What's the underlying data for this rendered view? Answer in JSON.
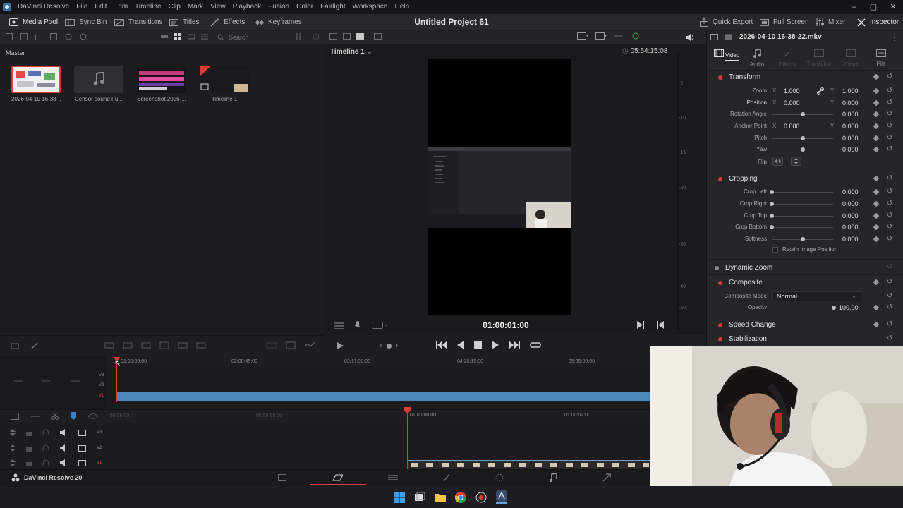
{
  "menubar": {
    "app_title": "DaVinci Resolve",
    "items": [
      "File",
      "Edit",
      "Trim",
      "Timeline",
      "Clip",
      "Mark",
      "View",
      "Playback",
      "Fusion",
      "Color",
      "Fairlight",
      "Workspace",
      "Help"
    ]
  },
  "toolbar": {
    "media_pool": "Media Pool",
    "sync_bin": "Sync Bin",
    "transitions": "Transitions",
    "titles": "Titles",
    "effects": "Effects",
    "keyframes": "Keyframes",
    "project_title": "Untitled Project 61",
    "quick_export": "Quick Export",
    "full_screen": "Full Screen",
    "mixer": "Mixer",
    "inspector": "Inspector"
  },
  "mediapool": {
    "search_placeholder": "Search",
    "bin": "Master",
    "clips": [
      {
        "name": "2026-04-10 16-38-..."
      },
      {
        "name": "Censor sound Fu..."
      },
      {
        "name": "Screenshot 2026-..."
      },
      {
        "name": "Timeline 1"
      }
    ]
  },
  "viewer": {
    "timeline_name": "Timeline 1",
    "source_timecode": "05:54:15:08",
    "timecode": "01:00:01:00"
  },
  "meter": {
    "ticks": [
      "-5",
      "-10",
      "-15",
      "-20",
      "-30",
      "-40",
      "-50"
    ]
  },
  "inspector": {
    "file_name": "2026-04-10 16-38-22.mkv",
    "tabs": [
      "Video",
      "Audio",
      "Effects",
      "Transition",
      "Image",
      "File"
    ],
    "transform": {
      "title": "Transform",
      "zoom_label": "Zoom",
      "zoom_x": "1.000",
      "zoom_y": "1.000",
      "position_label": "Position",
      "position_x": "0.000",
      "position_y": "0.000",
      "rotation_label": "Rotation Angle",
      "rotation": "0.000",
      "anchor_label": "Anchor Point",
      "anchor_x": "0.000",
      "anchor_y": "0.000",
      "pitch_label": "Pitch",
      "pitch": "0.000",
      "yaw_label": "Yaw",
      "yaw": "0.000",
      "flip_label": "Flip",
      "x_label": "X",
      "y_label": "Y"
    },
    "cropping": {
      "title": "Cropping",
      "crop_left_label": "Crop Left",
      "crop_left": "0.000",
      "crop_right_label": "Crop Right",
      "crop_right": "0.000",
      "crop_top_label": "Crop Top",
      "crop_top": "0.000",
      "crop_bottom_label": "Crop Bottom",
      "crop_bottom": "0.000",
      "softness_label": "Softness",
      "softness": "0.000",
      "retain_label": "Retain Image Position"
    },
    "dynamic_zoom": "Dynamic Zoom",
    "composite": {
      "title": "Composite",
      "mode_label": "Composite Mode",
      "mode": "Normal",
      "opacity_label": "Opacity",
      "opacity": "100.00"
    },
    "speed_change": "Speed Change",
    "stabilization": "Stabilization"
  },
  "timeline": {
    "upper_ruler": [
      "01:00:00:00",
      "02:08:45:00",
      "03:17:30:00",
      "04:26:15:00",
      "05:35:00:00"
    ],
    "lower_ruler": [
      "59:56:00",
      "00:58:58:00",
      "01:00:00:00",
      "01:00:02:00"
    ],
    "tracks": [
      "V3",
      "V2",
      "V1"
    ]
  },
  "bottombar": {
    "app_name": "DaVinci Resolve 20"
  },
  "colors": {
    "accent": "#e03a3a",
    "clip_blue": "#4a86b8",
    "playhead": "#e03a3a"
  }
}
